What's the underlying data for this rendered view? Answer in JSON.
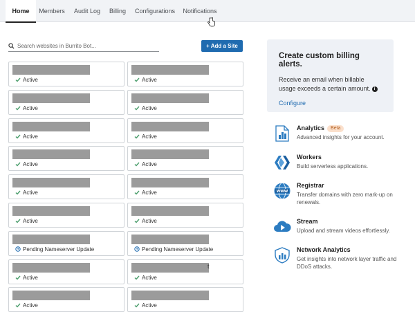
{
  "nav": {
    "tabs": [
      {
        "label": "Home"
      },
      {
        "label": "Members"
      },
      {
        "label": "Audit Log"
      },
      {
        "label": "Billing"
      },
      {
        "label": "Configurations"
      },
      {
        "label": "Notifications"
      }
    ],
    "active": "Home"
  },
  "search": {
    "placeholder": "Search websites in Burrito Bot..."
  },
  "add_site_label": "+ Add a Site",
  "sites": {
    "left": [
      {
        "status": "Active"
      },
      {
        "status": "Active"
      },
      {
        "status": "Active"
      },
      {
        "status": "Active"
      },
      {
        "status": "Active"
      },
      {
        "status": "Active"
      },
      {
        "status": "Pending Nameserver Update"
      },
      {
        "status": "Active"
      },
      {
        "status": "Active"
      }
    ],
    "right": [
      {
        "status": "Active"
      },
      {
        "status": "Active"
      },
      {
        "status": "Active"
      },
      {
        "status": "Active"
      },
      {
        "status": "Active"
      },
      {
        "status": "Active"
      },
      {
        "status": "Pending Nameserver Update"
      },
      {
        "status": "Active",
        "trailing_text": "t"
      },
      {
        "status": "Active"
      }
    ]
  },
  "billing_alert": {
    "title": "Create custom billing alerts.",
    "body": "Receive an email when billable usage exceeds a certain amount.",
    "link": "Configure"
  },
  "products": [
    {
      "name": "Analytics",
      "badge": "Beta",
      "desc": "Advanced insights for your account.",
      "icon": "analytics-icon"
    },
    {
      "name": "Workers",
      "desc": "Build serverless applications.",
      "icon": "workers-icon"
    },
    {
      "name": "Registrar",
      "desc": "Transfer domains with zero mark-up on renewals.",
      "icon": "registrar-icon"
    },
    {
      "name": "Stream",
      "desc": "Upload and stream videos effortlessly.",
      "icon": "stream-icon"
    },
    {
      "name": "Network Analytics",
      "desc": "Get insights into network layer traffic and DDoS attacks.",
      "icon": "network-analytics-icon"
    }
  ],
  "colors": {
    "accent": "#1f6bb0",
    "active_check": "#4a9d6b",
    "pending": "#1f6bb0",
    "alert_bg": "#eef1f6"
  }
}
